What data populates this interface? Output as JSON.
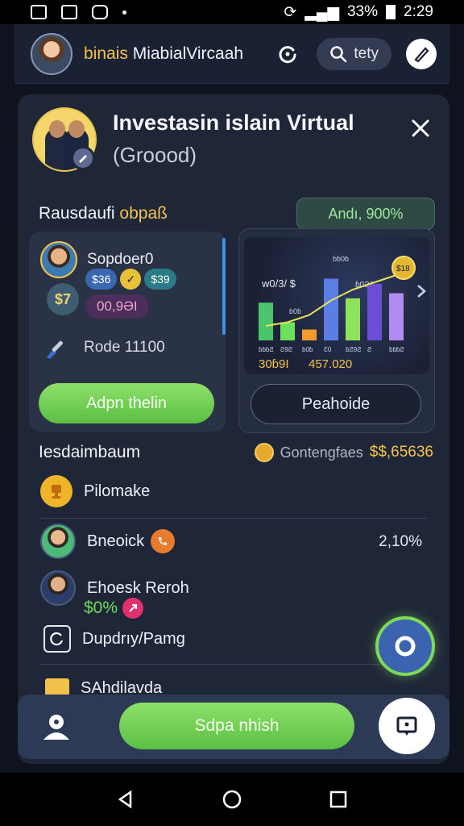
{
  "status_bar": {
    "battery_percent": "33%",
    "time": "2:29"
  },
  "header": {
    "app_title_accent": "binais",
    "app_title_rest": " MiabialVircaah",
    "search_label": "tety"
  },
  "card": {
    "title": "Investasin islain Virtual",
    "subtitle": "(Groood)"
  },
  "section1": {
    "title_main": "Rausdaufi ",
    "title_accent": "obpaß",
    "rate_badge": "Andı, 900%"
  },
  "left_panel": {
    "user_name": "Sopdoer0",
    "tags": [
      "$36",
      "✓",
      "$39"
    ],
    "amount": "00,9ƏI",
    "coin_symbol": "$7",
    "code_text": "Rode 11100",
    "action_button": "Adpn thelin"
  },
  "right_panel": {
    "chart_labels": {
      "top": "ɓɓ0ɓ",
      "left": "w0/3/ $",
      "mid": "ɓ0Ƨ6",
      "small": "ɓ0ɓ",
      "coin": "$18"
    },
    "chart_data": {
      "type": "bar",
      "categories": [
        "ɓɓɓƧ",
        "Ƨ9Ƨ",
        "ɓ0ɓ",
        "Ɛ0",
        "ɓƧ9Ƨ",
        "Ƨ",
        "ɓɓɓƧ"
      ],
      "values_note": "",
      "values": [
        52,
        25,
        15,
        85,
        58,
        78,
        65
      ],
      "line": [
        20,
        25,
        35,
        55,
        70,
        80,
        90
      ],
      "colors": [
        "#4bc56a",
        "#6be05a",
        "#f39b2b",
        "#5a7de6",
        "#8ee35a",
        "#6a4fd6",
        "#b18cf0"
      ]
    },
    "values_left": "30ɓ9I",
    "values_right": "457.020",
    "outline_button": "Peahoide"
  },
  "section2": {
    "title": "Iesdaimbaum",
    "right_label": "Gontengfaes",
    "right_amount": "$$,65636"
  },
  "list": [
    {
      "label": "Pilomake"
    },
    {
      "label": "Bneoick",
      "right": "2,10%"
    },
    {
      "label": "Ehoesk Reroh",
      "value": "$0%"
    },
    {
      "label": "Dupdrıy/Pamg"
    },
    {
      "label": "SAhdilavda"
    }
  ],
  "bottom": {
    "primary_button": "Sdpa nhish"
  },
  "colors": {
    "accent_gold": "#f3c34a",
    "accent_green": "#7ed957",
    "card_bg": "#1f2638"
  }
}
